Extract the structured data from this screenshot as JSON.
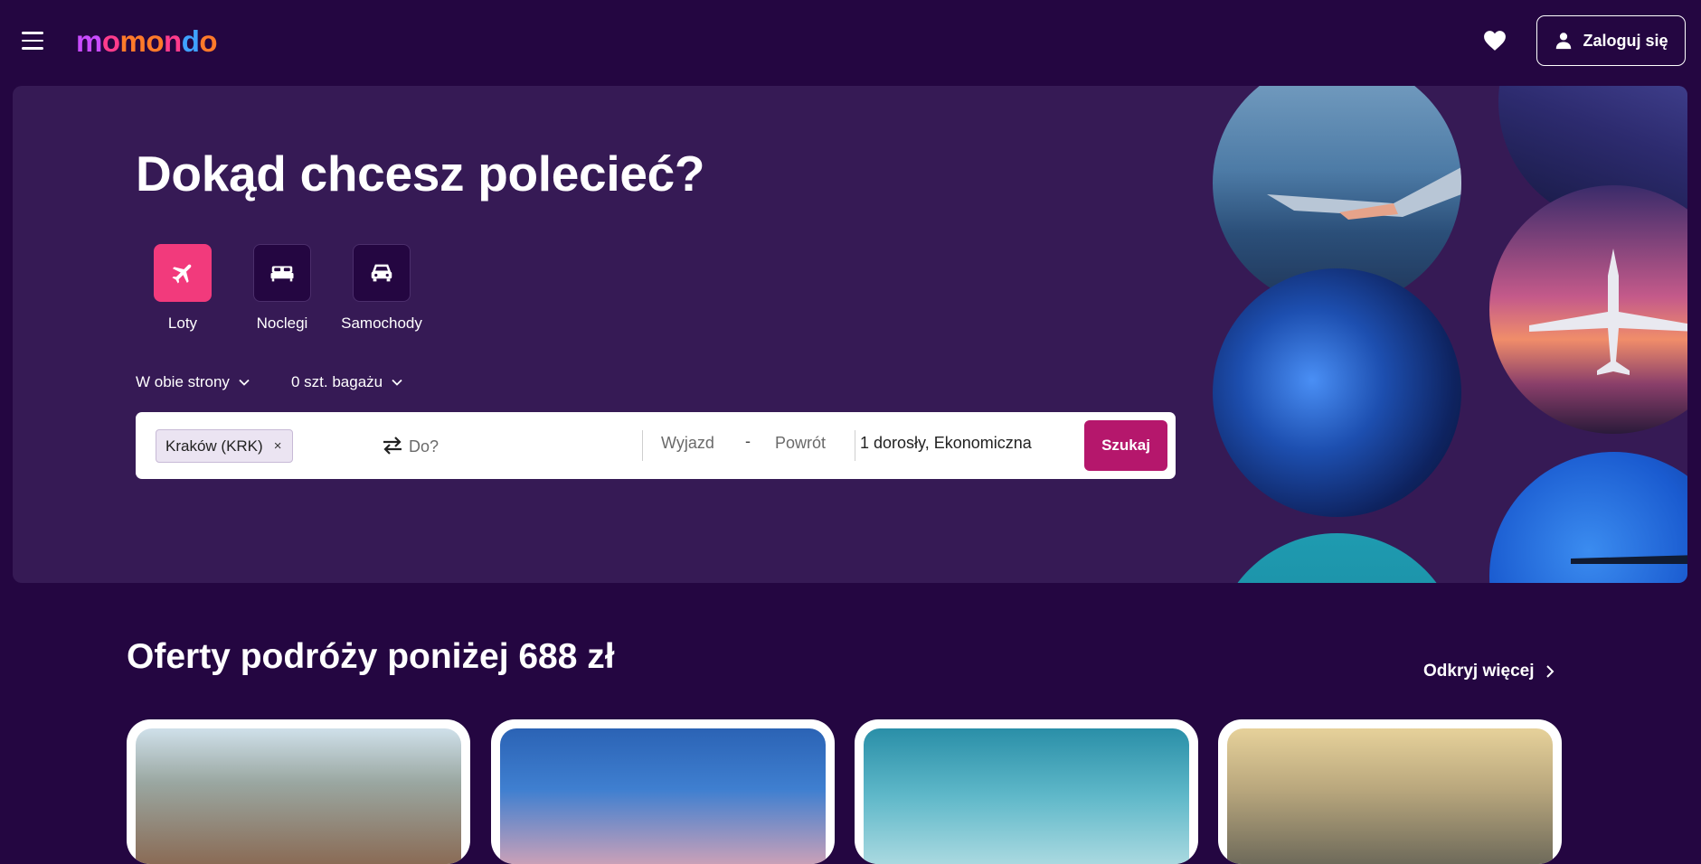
{
  "header": {
    "logo": "momondo",
    "login_label": "Zaloguj się"
  },
  "hero": {
    "title": "Dokąd chcesz polecieć?",
    "verticals": [
      {
        "label": "Loty",
        "icon": "plane-icon",
        "active": true
      },
      {
        "label": "Noclegi",
        "icon": "bed-icon",
        "active": false
      },
      {
        "label": "Samochody",
        "icon": "car-icon",
        "active": false
      }
    ],
    "trip_type": "W obie strony",
    "bags": "0 szt. bagażu"
  },
  "search": {
    "origin_chip": "Kraków (KRK)",
    "origin_remove": "×",
    "destination_placeholder": "Do?",
    "depart_placeholder": "Wyjazd",
    "date_separator": "-",
    "return_placeholder": "Powrót",
    "travelers": "1 dorosły, Ekonomiczna",
    "submit_label": "Szukaj"
  },
  "deals": {
    "title": "Oferty podróży poniżej 688 zł",
    "discover_label": "Odkryj więcej"
  },
  "colors": {
    "background": "#240641",
    "hero_panel": "#361a55",
    "accent_pink": "#f23a7c",
    "search_button": "#b5176c"
  }
}
